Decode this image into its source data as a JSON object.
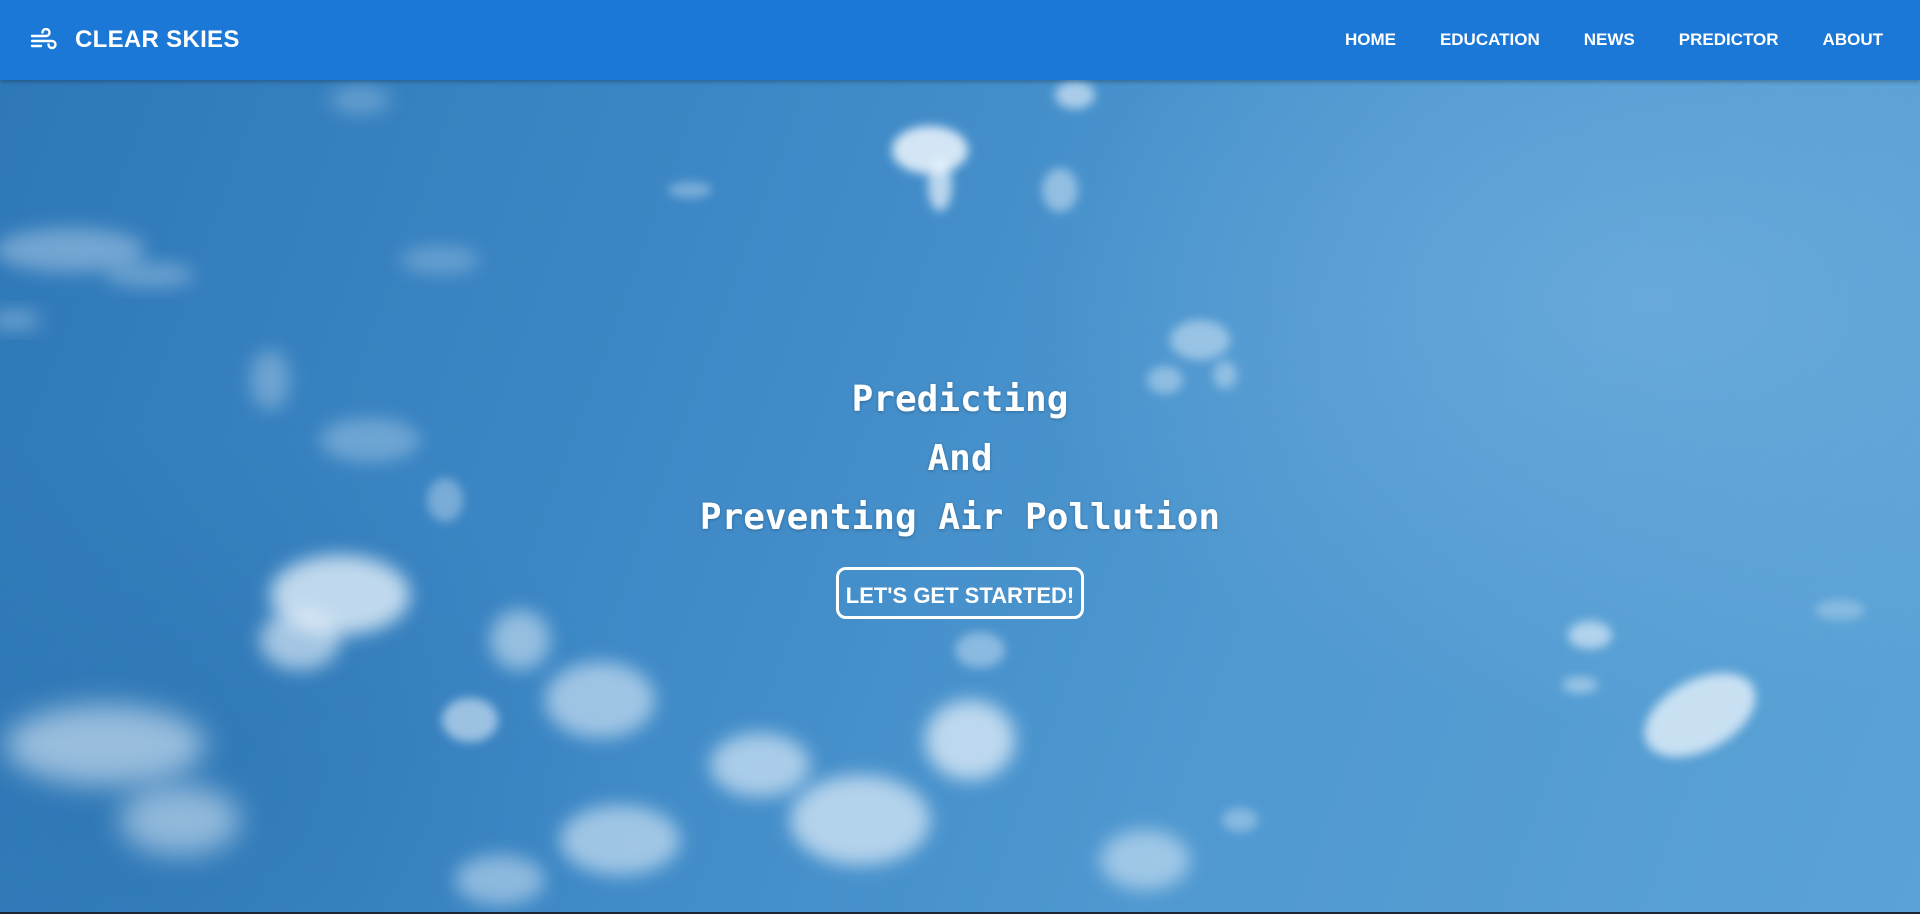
{
  "navbar": {
    "brand_icon": "wind-icon",
    "brand_name": "CLEAR SKIES",
    "links": [
      {
        "label": "HOME"
      },
      {
        "label": "EDUCATION"
      },
      {
        "label": "NEWS"
      },
      {
        "label": "PREDICTOR"
      },
      {
        "label": "ABOUT"
      }
    ]
  },
  "hero": {
    "title_lines": [
      "Predicting",
      "And",
      "Preventing Air Pollution"
    ],
    "cta_label": "LET'S GET STARTED!",
    "background": "blue-sky-with-clouds"
  },
  "colors": {
    "navbar": "#1b78d6",
    "sky": "#3d88c6",
    "text": "#ffffff"
  }
}
